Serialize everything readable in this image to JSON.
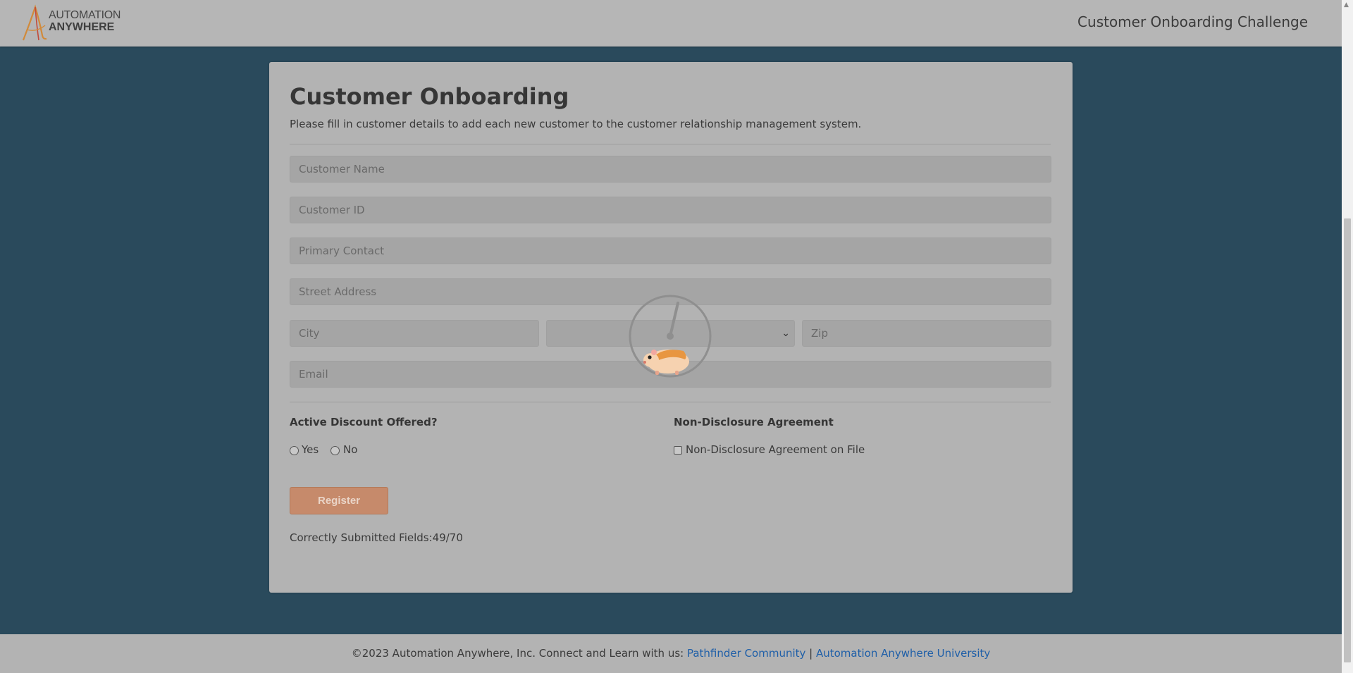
{
  "header": {
    "logo_line1": "AUTOMATION",
    "logo_line2": "ANYWHERE",
    "title": "Customer Onboarding Challenge"
  },
  "form": {
    "title": "Customer Onboarding",
    "subtitle": "Please fill in customer details to add each new customer to the customer relationship management system.",
    "customer_name_placeholder": "Customer Name",
    "customer_id_placeholder": "Customer ID",
    "primary_contact_placeholder": "Primary Contact",
    "street_address_placeholder": "Street Address",
    "city_placeholder": "City",
    "state_selected": "",
    "zip_placeholder": "Zip",
    "email_placeholder": "Email",
    "discount_label": "Active Discount Offered?",
    "discount_yes": "Yes",
    "discount_no": "No",
    "nda_label": "Non-Disclosure Agreement",
    "nda_option": "Non-Disclosure Agreement on File",
    "register_label": "Register",
    "status_text": "Correctly Submitted Fields:49/70"
  },
  "footer": {
    "prefix": "©2023 Automation Anywhere, Inc. Connect and Learn with us: ",
    "link1": "Pathfinder Community",
    "separator": " | ",
    "link2": "Automation Anywhere University"
  },
  "icons": {
    "logo": "automation-anywhere-logo",
    "loader": "hamster-wheel-loading-icon",
    "chevron": "chevron-down-icon"
  },
  "colors": {
    "background": "#2a4a5c",
    "register_button": "#c68a6b",
    "link": "#1f5fa8"
  }
}
